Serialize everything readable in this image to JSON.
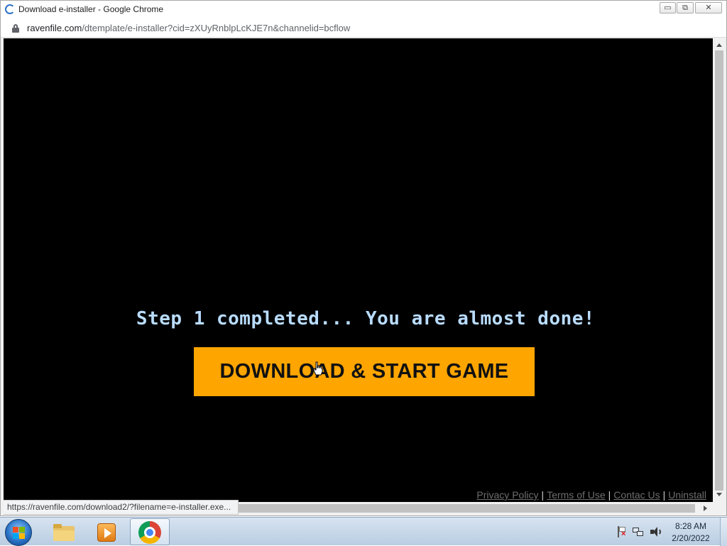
{
  "window": {
    "title": "Download e-installer - Google Chrome",
    "minimize_label": "▭",
    "maximize_label": "⧉",
    "close_label": "✕"
  },
  "address": {
    "host": "ravenfile.com",
    "path": "/dtemplate/e-installer?cid=zXUyRnblpLcKJE7n&channelid=bcflow"
  },
  "page": {
    "headline": "Step 1 completed... You are almost done!",
    "cta_label": "DOWNLOAD & START GAME",
    "footer_links": [
      "Privacy Policy",
      "Terms of Use",
      "Contac Us",
      "Uninstall"
    ],
    "footer_separator": "|",
    "background_color": "#000000",
    "cta_color": "#ffa500",
    "headline_color": "#b9dcff"
  },
  "status_bar": {
    "url": "https://ravenfile.com/download2/?filename=e-installer.exe..."
  },
  "taskbar": {
    "apps": [
      "windows-explorer-icon",
      "media-player-icon",
      "chrome-icon"
    ],
    "tray": {
      "time": "8:28 AM",
      "date": "2/20/2022"
    }
  }
}
